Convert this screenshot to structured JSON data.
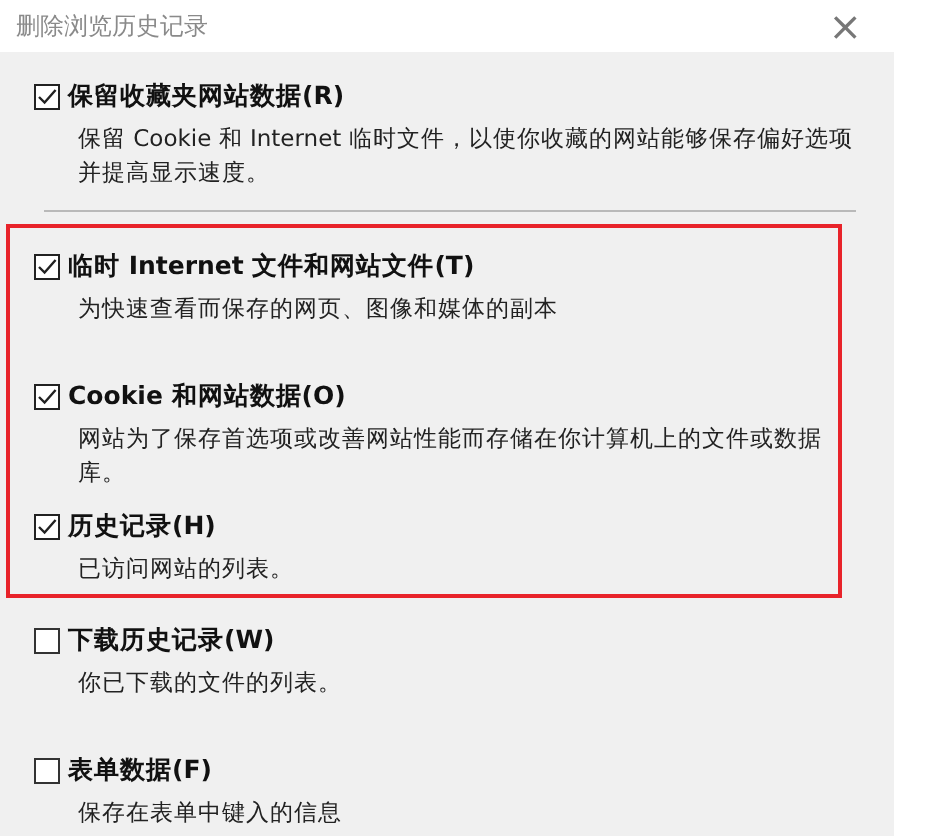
{
  "window": {
    "title": "删除浏览历史记录",
    "close": "×"
  },
  "sections": [
    {
      "highlighted": false,
      "rule_below": true,
      "options": [
        {
          "label": "保留收藏夹网站数据(R)",
          "checked": true,
          "description": "保留 Cookie 和 Internet 临时文件，以使你收藏的网站能够保存偏好选项并提高显示速度。"
        }
      ]
    },
    {
      "highlighted": true,
      "options": [
        {
          "label": "临时 Internet 文件和网站文件(T)",
          "checked": true,
          "description": "为快速查看而保存的网页、图像和媒体的副本"
        },
        {
          "label": "Cookie 和网站数据(O)",
          "checked": true,
          "description": "网站为了保存首选项或改善网站性能而存储在你计算机上的文件或数据库。"
        },
        {
          "label": "历史记录(H)",
          "checked": true,
          "description": "已访问网站的列表。"
        }
      ]
    },
    {
      "highlighted": false,
      "options": [
        {
          "label": "下载历史记录(W)",
          "checked": false,
          "description": "你已下载的文件的列表。"
        },
        {
          "label": "表单数据(F)",
          "checked": false,
          "description": "保存在表单中键入的信息"
        }
      ]
    }
  ]
}
